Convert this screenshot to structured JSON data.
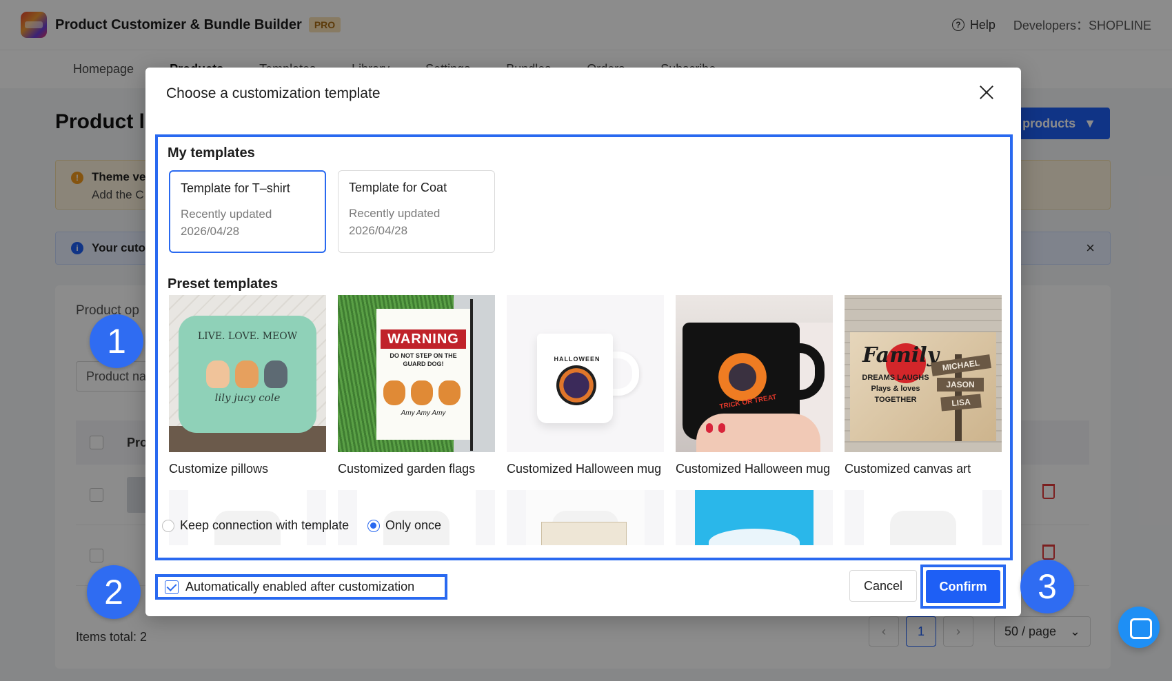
{
  "app": {
    "title": "Product Customizer & Bundle Builder",
    "badge": "PRO",
    "help": "Help",
    "developer": "Developers：SHOPLINE"
  },
  "nav": {
    "items": [
      "Homepage",
      "Products",
      "Templates",
      "Library",
      "Settings",
      "Bundles",
      "Orders",
      "Subscribe"
    ],
    "active": "Products"
  },
  "page": {
    "title": "Product l",
    "add_button": "products",
    "warning_title": "Theme ve",
    "warning_sub": "Add the C",
    "info_text": "Your cuto",
    "panel_label": "Product op",
    "search_placeholder": "Product na",
    "table_header": "Pro",
    "items_total": "Items total: 2",
    "pager_current": "1",
    "page_size": "50 / page"
  },
  "modal": {
    "title": "Choose a customization template",
    "my_templates_heading": "My templates",
    "my_templates": [
      {
        "title": "Template for T–shirt",
        "status": "Recently updated",
        "date": "2026/04/28",
        "selected": true
      },
      {
        "title": "Template for Coat",
        "status": "Recently updated",
        "date": "2026/04/28",
        "selected": false
      }
    ],
    "preset_heading": "Preset templates",
    "presets": [
      {
        "label": "Customize pillows",
        "icon": "pillow-image"
      },
      {
        "label": "Customized garden flags",
        "icon": "garden-flag-image"
      },
      {
        "label": "Customized Halloween mug",
        "icon": "white-mug-image"
      },
      {
        "label": "Customized Halloween mug",
        "icon": "black-mug-image"
      },
      {
        "label": "Customized canvas art",
        "icon": "canvas-art-image"
      }
    ],
    "pillow_art": {
      "line1": "LIVE. LOVE. MEOW",
      "names": "lily   jucy   cole"
    },
    "flag_art": {
      "warning": "WARNING",
      "line": "DO NOT STEP ON THE GUARD DOG!",
      "names": "Amy  Amy  Amy"
    },
    "mug_art": {
      "arc": "HALLOWEEN"
    },
    "blackmug_art": {
      "text": "TRICK OR TREAT"
    },
    "canvas_art": {
      "family": "Family",
      "sub": "DREAMS LAUGHS Plays & loves TOGETHER",
      "signs": [
        "MICHAEL",
        "JASON",
        "LISA"
      ]
    },
    "connection_option": "Keep connection with template",
    "once_option": "Only once",
    "connection_selected": "once",
    "auto_enable": "Automatically enabled after customization",
    "auto_enable_checked": true,
    "cancel": "Cancel",
    "confirm": "Confirm"
  },
  "steps": [
    "1",
    "2",
    "3"
  ],
  "colors": {
    "accent": "#2969f0",
    "primary_button": "#1e5ff5"
  }
}
